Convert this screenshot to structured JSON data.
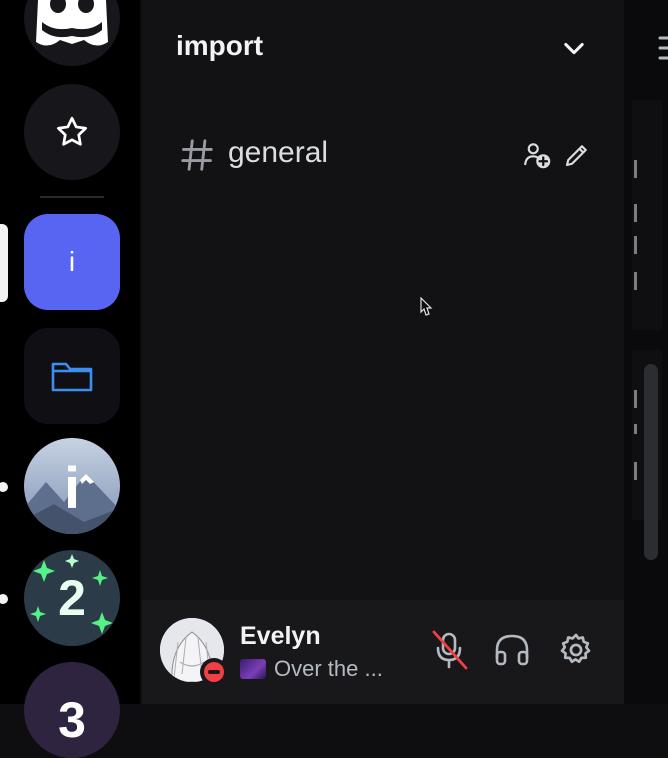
{
  "servers": {
    "active_letter": "i",
    "server_i_letter": "i",
    "server_2_letter": "2",
    "server_3_letter": "3"
  },
  "guild": {
    "name": "import"
  },
  "channels": [
    {
      "name": "general"
    }
  ],
  "user": {
    "name": "Evelyn",
    "custom_status": "Over the ...",
    "presence": "do-not-disturb"
  },
  "colors": {
    "blurple": "#5865f2",
    "dnd_red": "#f23f43",
    "folder_blue": "#3d8ef0"
  },
  "icons": [
    "discord-logo-icon",
    "star-icon",
    "folder-icon",
    "chevron-down-icon",
    "hash-icon",
    "add-member-icon",
    "pencil-icon",
    "mic-muted-icon",
    "headset-icon",
    "gear-icon"
  ]
}
